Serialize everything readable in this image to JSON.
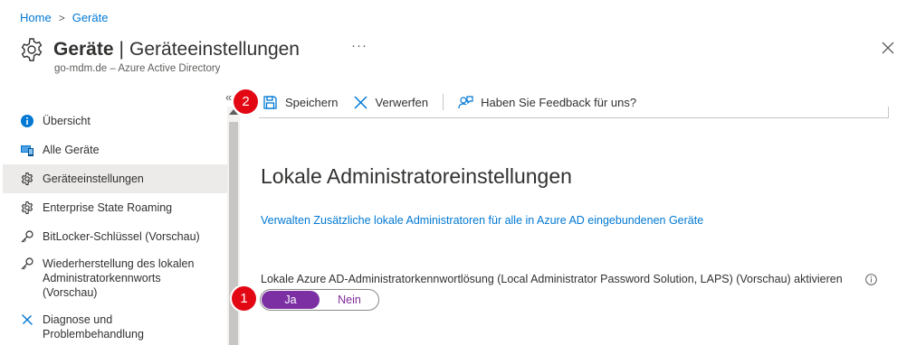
{
  "breadcrumb": {
    "home": "Home",
    "separator": ">",
    "current": "Geräte"
  },
  "header": {
    "title": "Geräte",
    "separator": "|",
    "subtitle_title": "Geräteeinstellungen",
    "more": "···",
    "tenant": "go-mdm.de – Azure Active Directory"
  },
  "sidebar": {
    "collapse": "«",
    "items": [
      {
        "label": "Übersicht",
        "icon": "info-icon"
      },
      {
        "label": "Alle Geräte",
        "icon": "devices-icon"
      },
      {
        "label": "Geräteeinstellungen",
        "icon": "gear-icon",
        "active": true
      },
      {
        "label": "Enterprise State Roaming",
        "icon": "gear-icon"
      },
      {
        "label": "BitLocker-Schlüssel (Vorschau)",
        "icon": "key-icon"
      },
      {
        "label_lines": [
          "Wiederherstellung des lokalen",
          "Administratorkennworts",
          "(Vorschau)"
        ],
        "icon": "key-icon"
      },
      {
        "label_lines": [
          "Diagnose und",
          "Problembehandlung"
        ],
        "icon": "wrench-icon"
      }
    ]
  },
  "toolbar": {
    "save_label": "Speichern",
    "discard_label": "Verwerfen",
    "feedback_label": "Haben Sie Feedback für uns?"
  },
  "main": {
    "section_title": "Lokale Administratoreinstellungen",
    "admin_link": "Verwalten Zusätzliche lokale Administratoren für alle in Azure AD eingebundenen Geräte",
    "laps_label": "Lokale Azure AD-Administratorkennwortlösung (Local Administrator Password Solution, LAPS) (Vorschau) aktivieren",
    "toggle": {
      "yes": "Ja",
      "no": "Nein",
      "selected": "Ja"
    }
  },
  "markers": {
    "one": "1",
    "two": "2"
  },
  "colors": {
    "link": "#0078d4",
    "toggle_on": "#7b2fa3",
    "marker": "#e30613"
  }
}
